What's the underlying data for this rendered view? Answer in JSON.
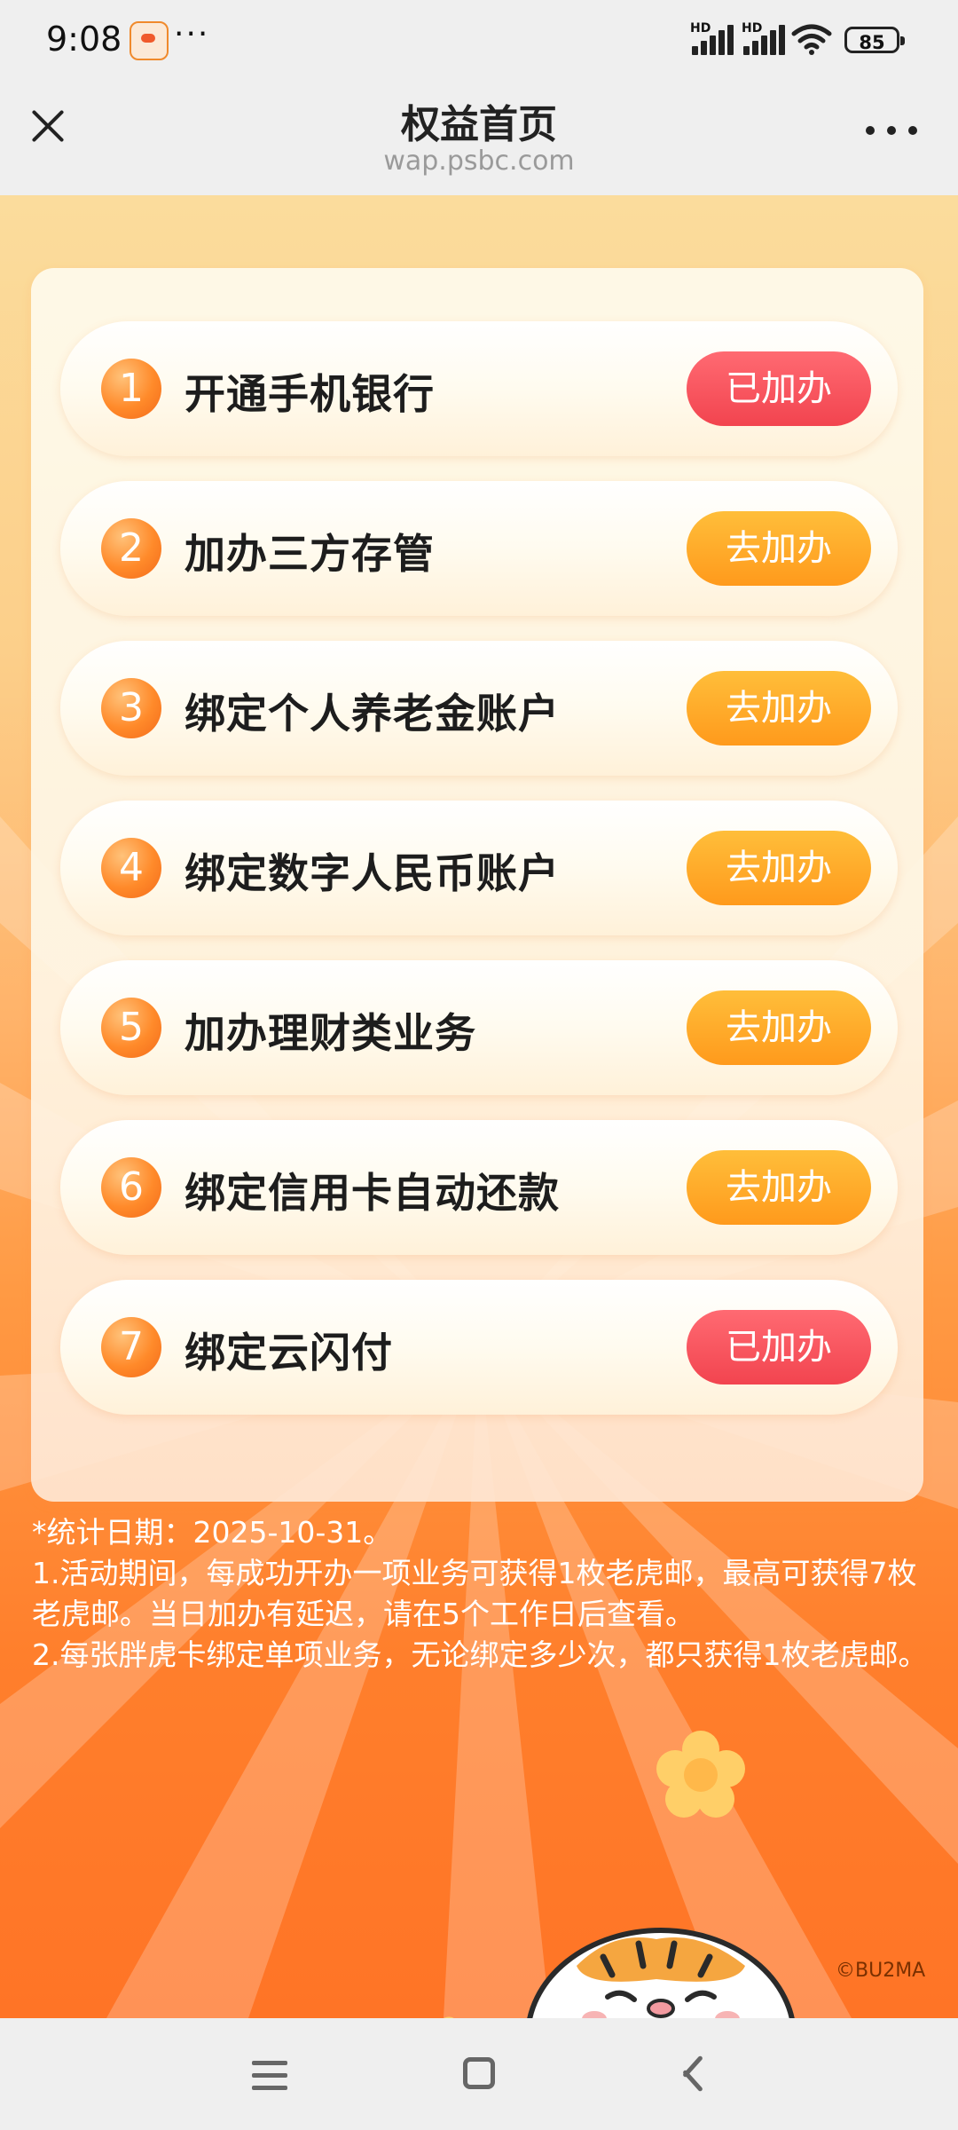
{
  "status": {
    "time": "9:08",
    "dots": "···",
    "hd1": "HD",
    "hd2": "HD",
    "battery": "85"
  },
  "header": {
    "title": "权益首页",
    "url": "wap.psbc.com"
  },
  "tasks": [
    {
      "num": "1",
      "label": "开通手机银行",
      "button": "已加办",
      "state": "done"
    },
    {
      "num": "2",
      "label": "加办三方存管",
      "button": "去加办",
      "state": "go"
    },
    {
      "num": "3",
      "label": "绑定个人养老金账户",
      "button": "去加办",
      "state": "go"
    },
    {
      "num": "4",
      "label": "绑定数字人民币账户",
      "button": "去加办",
      "state": "go"
    },
    {
      "num": "5",
      "label": "加办理财类业务",
      "button": "去加办",
      "state": "go"
    },
    {
      "num": "6",
      "label": "绑定信用卡自动还款",
      "button": "去加办",
      "state": "go"
    },
    {
      "num": "7",
      "label": "绑定云闪付",
      "button": "已加办",
      "state": "done"
    }
  ],
  "notes": {
    "date": "*统计日期：2025-10-31。",
    "rule1": "1.活动期间，每成功开办一项业务可获得1枚老虎邮，最高可获得7枚老虎邮。当日加办有延迟，请在5个工作日后查看。",
    "rule2": "2.每张胖虎卡绑定单项业务，无论绑定多少次，都只获得1枚老虎邮。"
  },
  "copyright": "©BU2MA",
  "colors": {
    "done_button": "#f2444f",
    "go_button": "#ff9a1c",
    "number_badge": "#ff8a2a"
  }
}
